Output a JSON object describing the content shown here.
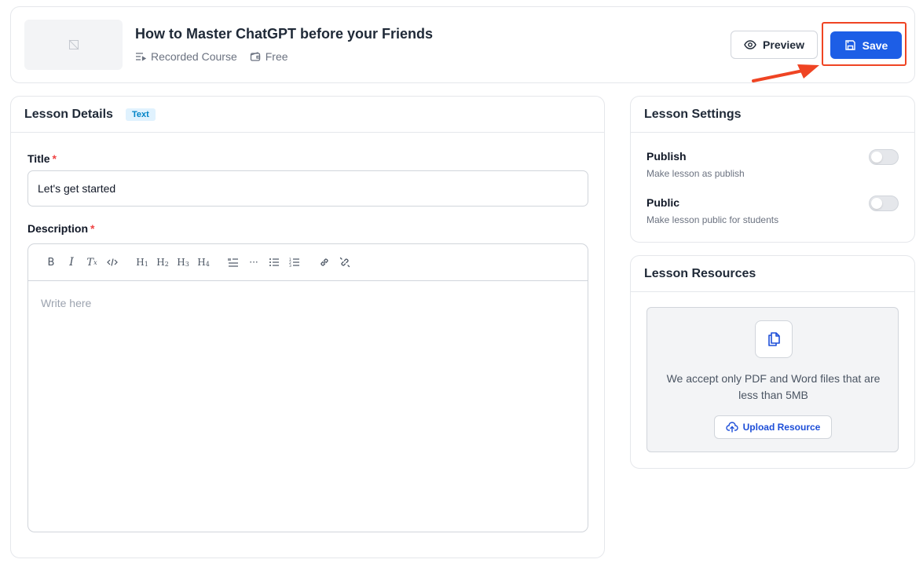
{
  "header": {
    "course_title": "How to Master ChatGPT before your Friends",
    "course_type": "Recorded Course",
    "price": "Free",
    "preview_label": "Preview",
    "save_label": "Save"
  },
  "lesson_details": {
    "title": "Lesson Details",
    "badge": "Text",
    "title_label": "Title",
    "required_mark": "*",
    "title_value": "Let's get started",
    "description_label": "Description",
    "editor_placeholder": "Write here",
    "toolbar": [
      "bold-icon",
      "italic-icon",
      "clear-format-icon",
      "code-icon",
      "h1-icon",
      "h2-icon",
      "h3-icon",
      "h4-icon",
      "blockquote-icon",
      "horizontal-rule-icon",
      "bullet-list-icon",
      "ordered-list-icon",
      "link-icon",
      "unlink-icon"
    ]
  },
  "lesson_settings": {
    "title": "Lesson Settings",
    "publish": {
      "name": "Publish",
      "desc": "Make lesson as publish",
      "enabled": false
    },
    "public": {
      "name": "Public",
      "desc": "Make lesson public for students",
      "enabled": false
    }
  },
  "lesson_resources": {
    "title": "Lesson Resources",
    "accept_text": "We accept only PDF and Word files that are less than 5MB",
    "upload_label": "Upload Resource"
  },
  "colors": {
    "primary": "#1d5ee6",
    "highlight": "#ef4423",
    "required": "#ef4444",
    "badge_bg": "#e0f2fe",
    "badge_text": "#0284c7"
  }
}
